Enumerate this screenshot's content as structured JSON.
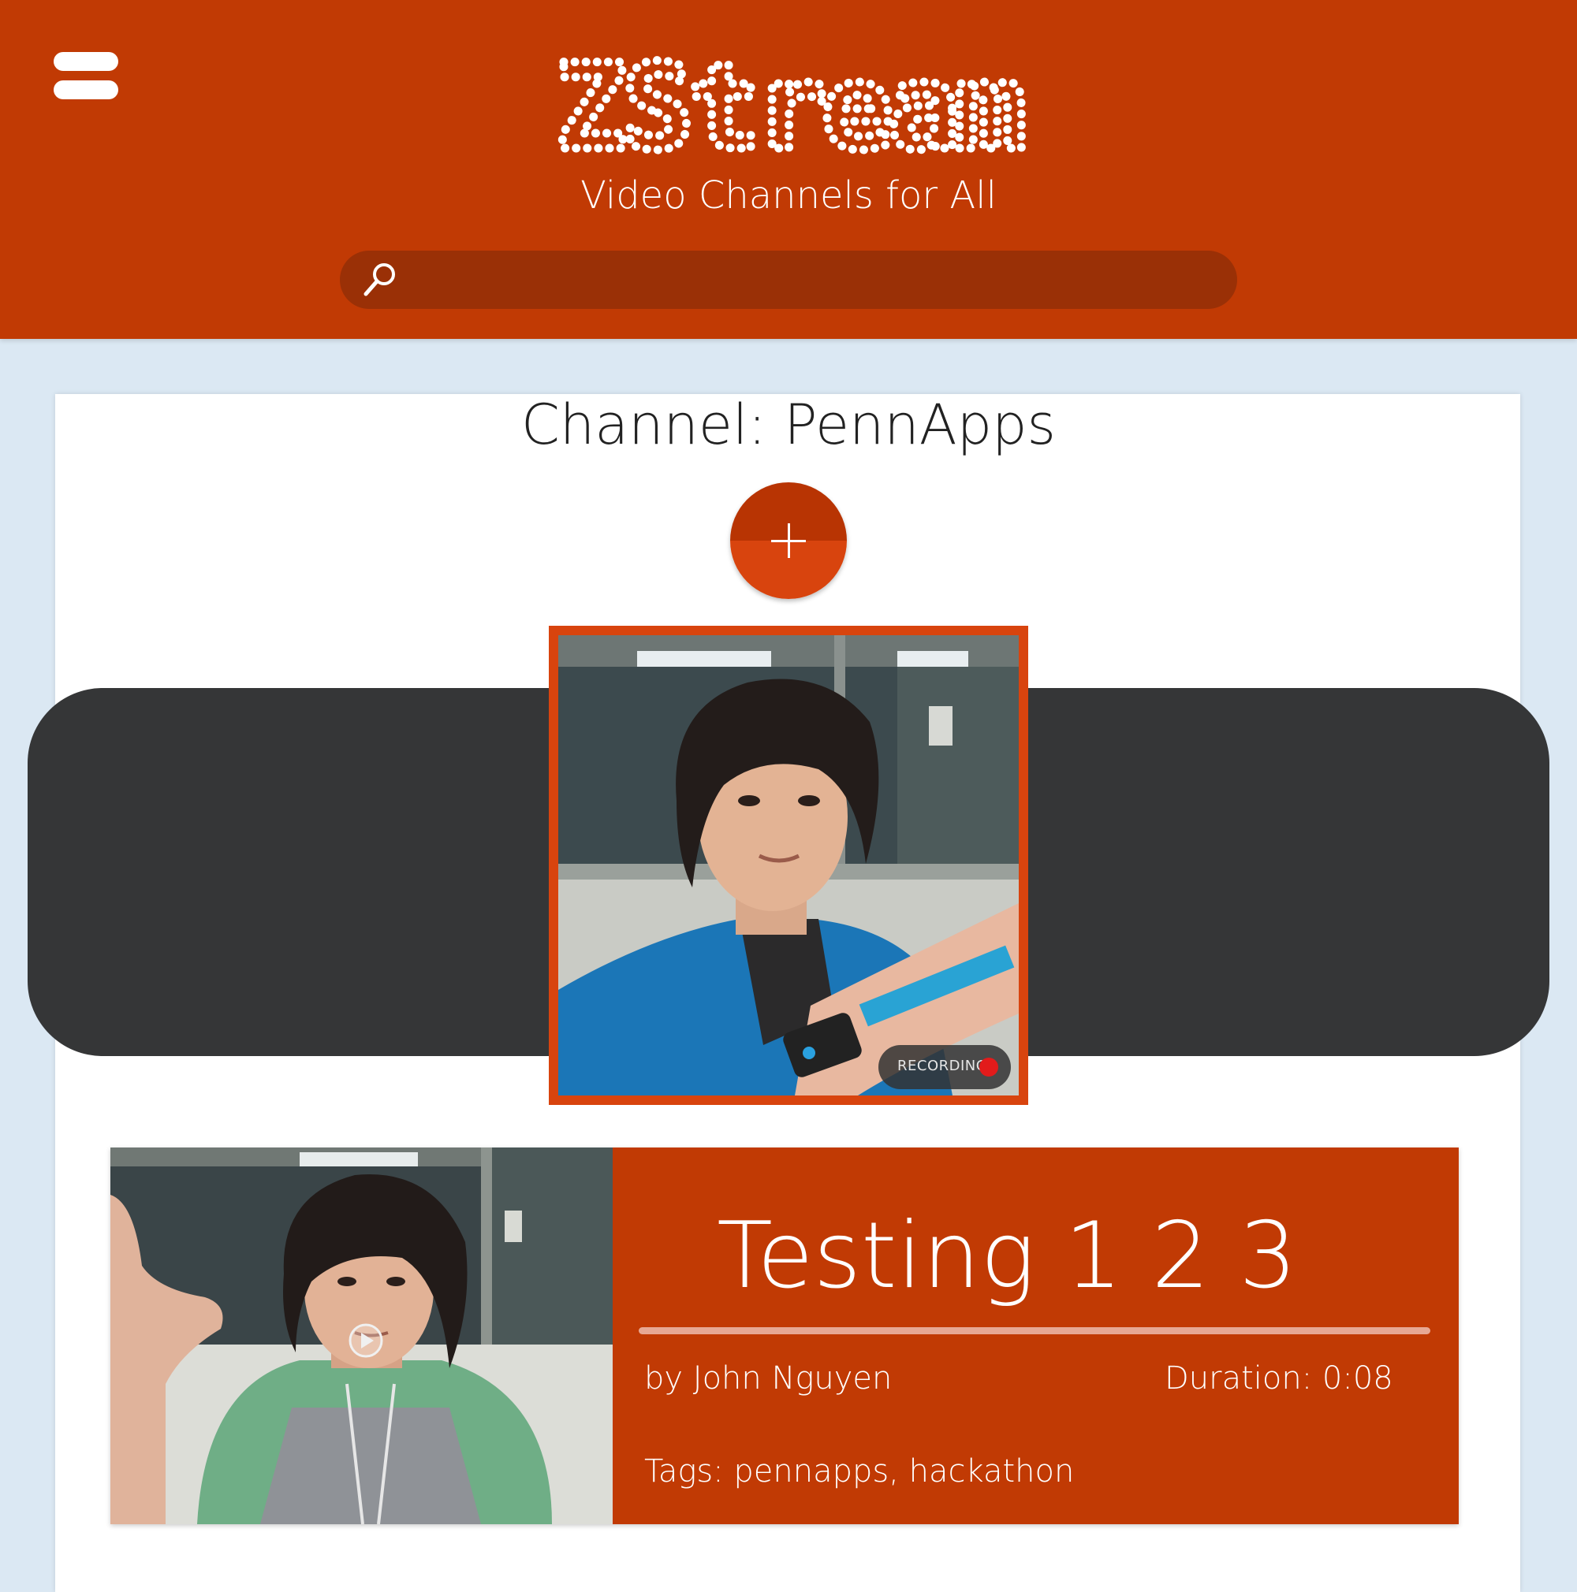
{
  "app": {
    "logo_text": "ZStream",
    "tagline": "Video Channels for All"
  },
  "search": {
    "placeholder": ""
  },
  "channel": {
    "title": "Channel: PennApps"
  },
  "recorder": {
    "status_label": "RECORDING"
  },
  "videos": [
    {
      "title": "Testing 1 2 3",
      "author": "by John Nguyen",
      "duration_label": "Duration: ",
      "duration": "0:08",
      "tags_label": "Tags: ",
      "tags": "pennapps, hackathon"
    }
  ],
  "colors": {
    "header": "#c13a04",
    "search_bar": "#9a3006",
    "page_bg": "#dbe8f3",
    "accent": "#d8440e",
    "dark_band": "#353637",
    "recording_dot": "#e21b1b"
  },
  "icons": {
    "menu": "hamburger-icon",
    "search": "search-icon",
    "add": "plus-icon",
    "recording": "record-dot-icon",
    "play": "play-icon"
  }
}
